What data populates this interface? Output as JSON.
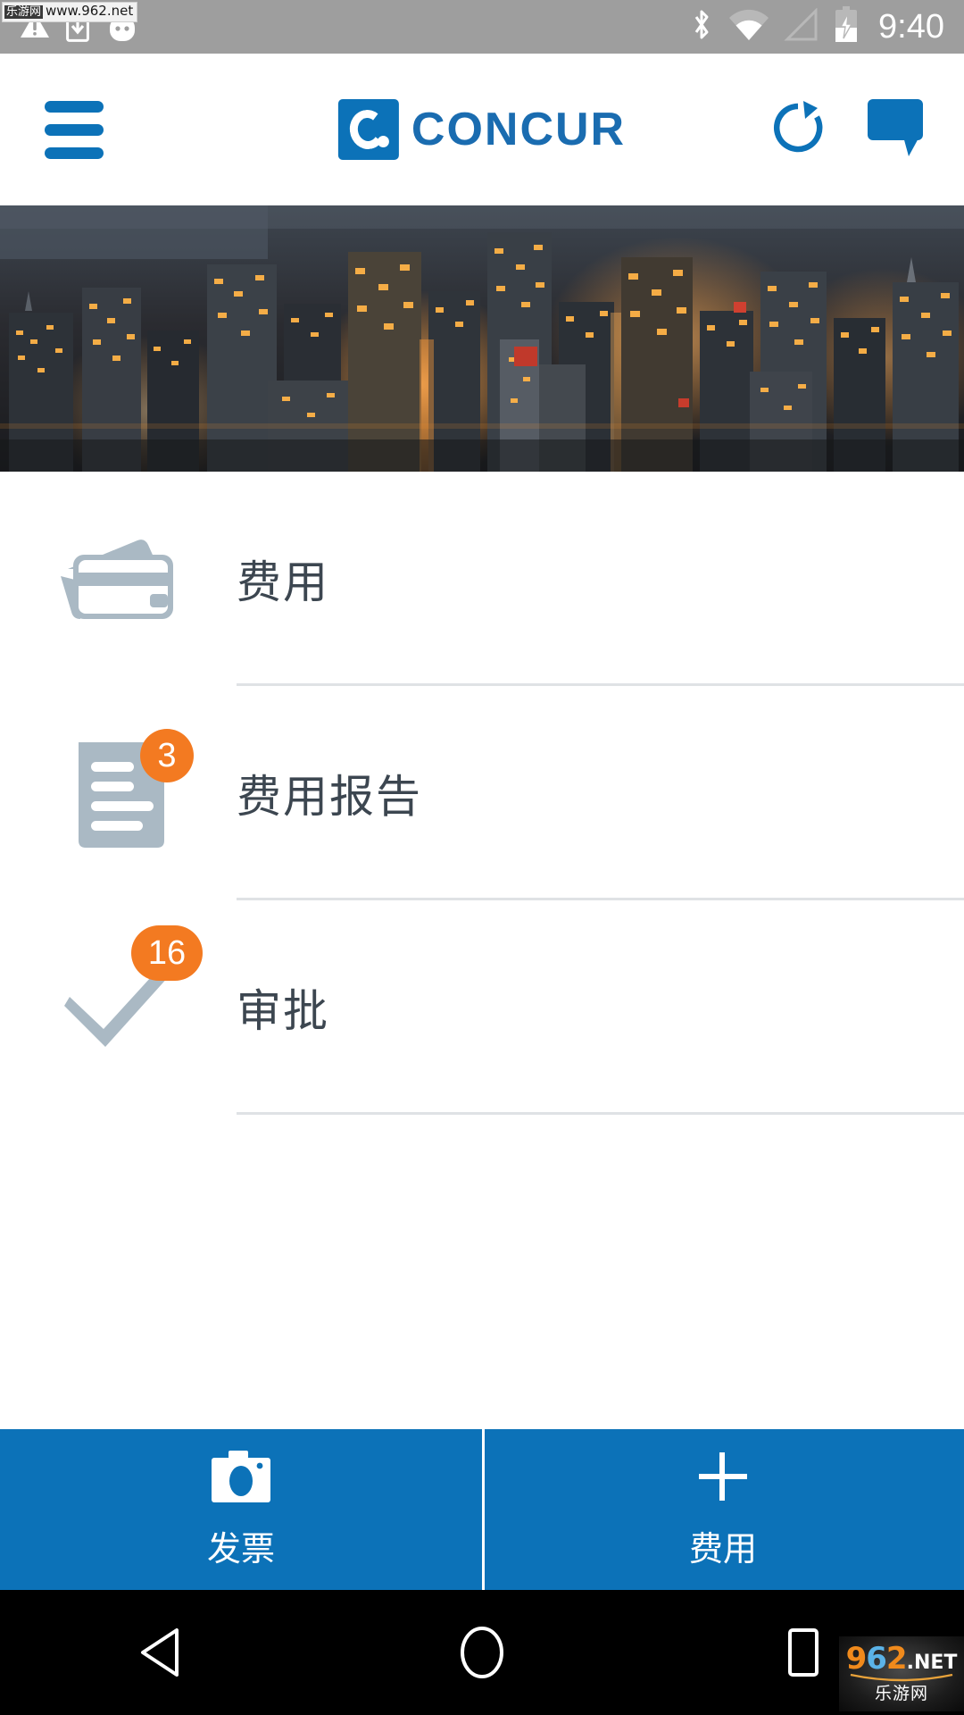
{
  "status_bar": {
    "time": "9:40",
    "left_icons": [
      "warning-triangle-icon",
      "download-icon",
      "android-head-icon"
    ],
    "right_icons": [
      "bluetooth-icon",
      "wifi-icon",
      "cell-signal-icon",
      "battery-charging-icon"
    ],
    "background_color": "#9e9e9e"
  },
  "watermark_top": {
    "tag": "乐游网",
    "url": "www.962.net"
  },
  "header": {
    "menu_icon": "hamburger-menu-icon",
    "brand": "CONCUR",
    "brand_mark": "concur-c-logo",
    "refresh_icon": "refresh-icon",
    "chat_icon": "chat-bubble-icon",
    "accent_color": "#0c72b8"
  },
  "banner": {
    "name": "city-skyline-night-photo"
  },
  "list": {
    "items": [
      {
        "label": "费用",
        "icon": "credit-card-icon",
        "badge": null
      },
      {
        "label": "费用报告",
        "icon": "document-icon",
        "badge": "3"
      },
      {
        "label": "审批",
        "icon": "checkmark-icon",
        "badge": "16"
      }
    ],
    "badge_color": "#f37a21",
    "icon_color": "#aab9c4"
  },
  "action_bar": {
    "background_color": "#0c72b8",
    "actions": [
      {
        "label": "发票",
        "icon": "camera-icon"
      },
      {
        "label": "费用",
        "icon": "plus-icon"
      }
    ]
  },
  "nav_bar": {
    "back": "back-triangle-icon",
    "home": "home-circle-icon",
    "recents": "recents-square-icon"
  },
  "watermark_bottom": {
    "digits_9": "9",
    "digits_6": "6",
    "digits_2": "2",
    "net": ".NET",
    "cn": "乐游网"
  }
}
